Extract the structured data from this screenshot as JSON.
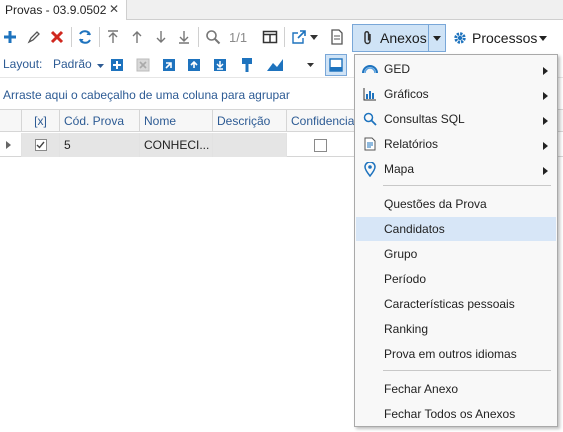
{
  "tab": {
    "title": "Provas - 03.9.0502",
    "close": "✕"
  },
  "toolbar": {
    "pager": "1/1",
    "anexos_label": "Anexos",
    "processos_label": "Processos"
  },
  "toolbar2": {
    "layout_label": "Layout:",
    "layout_value": "Padrão"
  },
  "group_hint": "Arraste aqui o cabeçalho de uma coluna para agrupar",
  "grid": {
    "columns": [
      "[x]",
      "Cód. Prova",
      "Nome",
      "Descrição",
      "Confidencial"
    ],
    "row": {
      "cod": "5",
      "nome": "CONHECI..."
    }
  },
  "menu": {
    "items_sub": [
      "GED",
      "Gráficos",
      "Consultas SQL",
      "Relatórios",
      "Mapa"
    ],
    "items_main": [
      "Questões da Prova",
      "Candidatos",
      "Grupo",
      "Período",
      "Características pessoais",
      "Ranking",
      "Prova em outros idiomas"
    ],
    "items_close": [
      "Fechar Anexo",
      "Fechar Todos os Anexos"
    ]
  },
  "colors": {
    "accent": "#1e73be",
    "highlight": "#d7e6f7",
    "link_text": "#2d5b94",
    "delete": "#d0281f"
  }
}
